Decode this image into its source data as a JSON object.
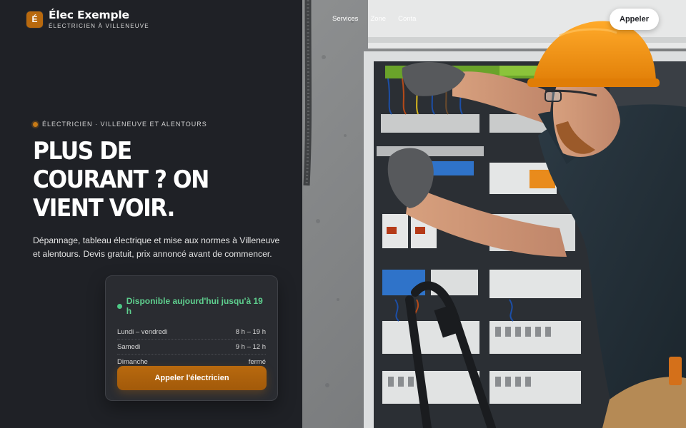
{
  "brand": {
    "mark": "É",
    "name": "Élec Exemple",
    "tagline": "ÉLECTRICIEN À VILLENEUVE",
    "accent_color": "#b8690e"
  },
  "nav": {
    "links": [
      "Services",
      "Zone",
      "Conta"
    ],
    "call_button": "Appeler"
  },
  "hero": {
    "eyebrow": "ÉLECTRICIEN · VILLENEUVE ET ALENTOURS",
    "headline_lines": [
      "PLUS DE",
      "COURANT ? ON",
      "VIENT VOIR."
    ],
    "lead": "Dépannage, tableau électrique et mise aux normes à Villeneuve et alentours. Devis gratuit, prix annoncé avant de commencer."
  },
  "hours_card": {
    "status": "Disponible aujourd'hui jusqu'à 19 h",
    "status_color": "#5fd08f",
    "rows": [
      {
        "day": "Lundi – vendredi",
        "time": "8 h – 19 h"
      },
      {
        "day": "Samedi",
        "time": "9 h – 12 h"
      },
      {
        "day": "Dimanche",
        "time": "fermé"
      }
    ],
    "cta": "Appeler l'électricien"
  },
  "photo": {
    "subject": "electrician-working-on-panel"
  }
}
